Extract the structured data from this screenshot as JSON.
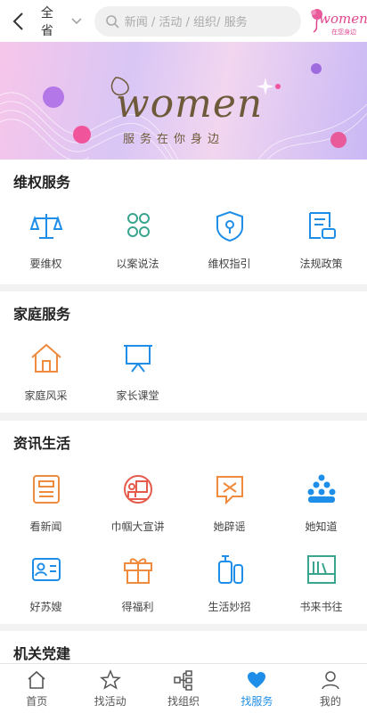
{
  "header": {
    "region": "全省",
    "search_placeholder": "新闻 / 活动 / 组织/ 服务",
    "logo_word": "women",
    "logo_sub": "在您身边"
  },
  "banner": {
    "word": "women",
    "tagline": "服务在你身边"
  },
  "sections": {
    "rights": {
      "title": "维权服务",
      "items": [
        "要维权",
        "以案说法",
        "维权指引",
        "法规政策"
      ]
    },
    "family": {
      "title": "家庭服务",
      "items": [
        "家庭风采",
        "家长课堂"
      ]
    },
    "life": {
      "title": "资讯生活",
      "items": [
        "看新闻",
        "巾帼大宣讲",
        "她辟谣",
        "她知道",
        "好苏嫂",
        "得福利",
        "生活妙招",
        "书来书往"
      ]
    },
    "party": {
      "title": "机关党建"
    }
  },
  "tabbar": {
    "tabs": [
      "首页",
      "找活动",
      "找组织",
      "找服务",
      "我的"
    ],
    "active_index": 3
  },
  "colors": {
    "blue": "#1f8ee8",
    "orange": "#f08a3c",
    "green": "#3aa58f",
    "red": "#e55a4a"
  }
}
